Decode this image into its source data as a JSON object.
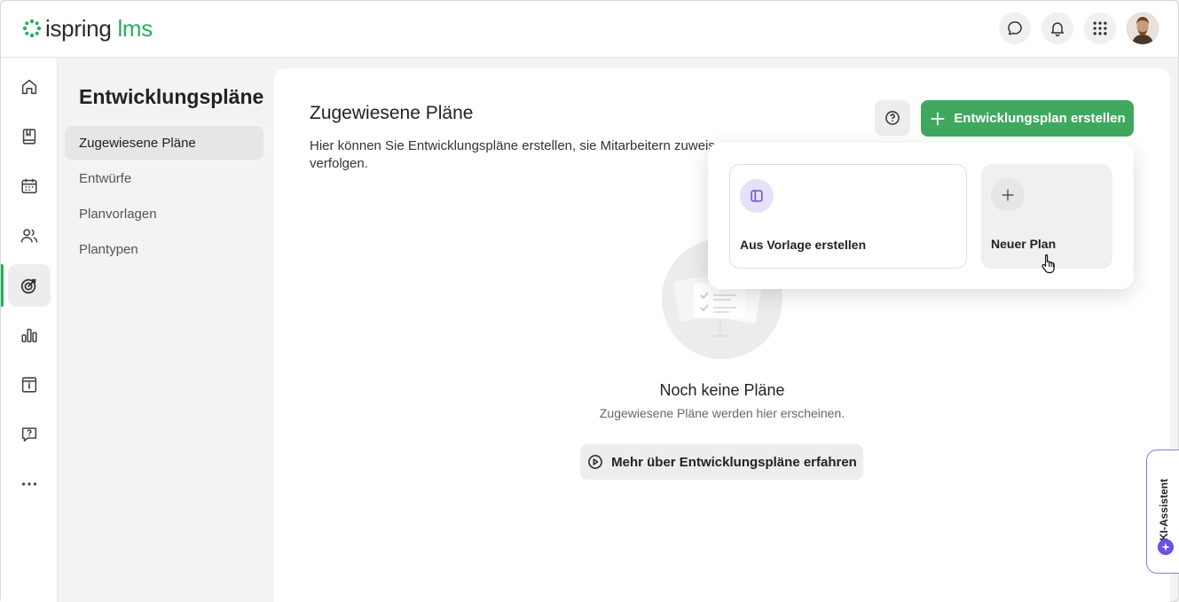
{
  "app": {
    "logo_primary": "ispring",
    "logo_secondary": "lms",
    "brand_color": "#27ae60"
  },
  "header": {
    "icons": [
      "chat-icon",
      "bell-icon",
      "apps-grid-icon",
      "avatar"
    ]
  },
  "rail": {
    "items": [
      "home-icon",
      "book-icon",
      "calendar-icon",
      "users-icon",
      "target-icon",
      "chart-icon",
      "info-box-icon",
      "help-chat-icon",
      "more-icon"
    ],
    "active": "target-icon"
  },
  "subnav": {
    "title": "Entwicklungspläne",
    "items": [
      {
        "label": "Zugewiesene Pläne",
        "active": true
      },
      {
        "label": "Entwürfe",
        "active": false
      },
      {
        "label": "Planvorlagen",
        "active": false
      },
      {
        "label": "Plantypen",
        "active": false
      }
    ]
  },
  "main": {
    "title": "Zugewiesene Pläne",
    "description_visible": "Hier können Sie Entwicklungspläne erstellen, sie Mitarbeitern zuweis",
    "description_tail": "verfolgen.",
    "create_button": "Entwicklungsplan erstellen",
    "empty_title": "Noch keine Pläne",
    "empty_subtitle": "Zugewiesene Pläne werden hier erscheinen.",
    "learn_button": "Mehr über Entwicklungspläne erfahren"
  },
  "dropdown": {
    "options": [
      {
        "label": "Aus Vorlage erstellen",
        "icon": "template-icon"
      },
      {
        "label": "Neuer Plan",
        "icon": "plus-icon"
      }
    ]
  },
  "ki_tab": {
    "label": "KI-Assistent",
    "accent": "#6c4de6"
  }
}
